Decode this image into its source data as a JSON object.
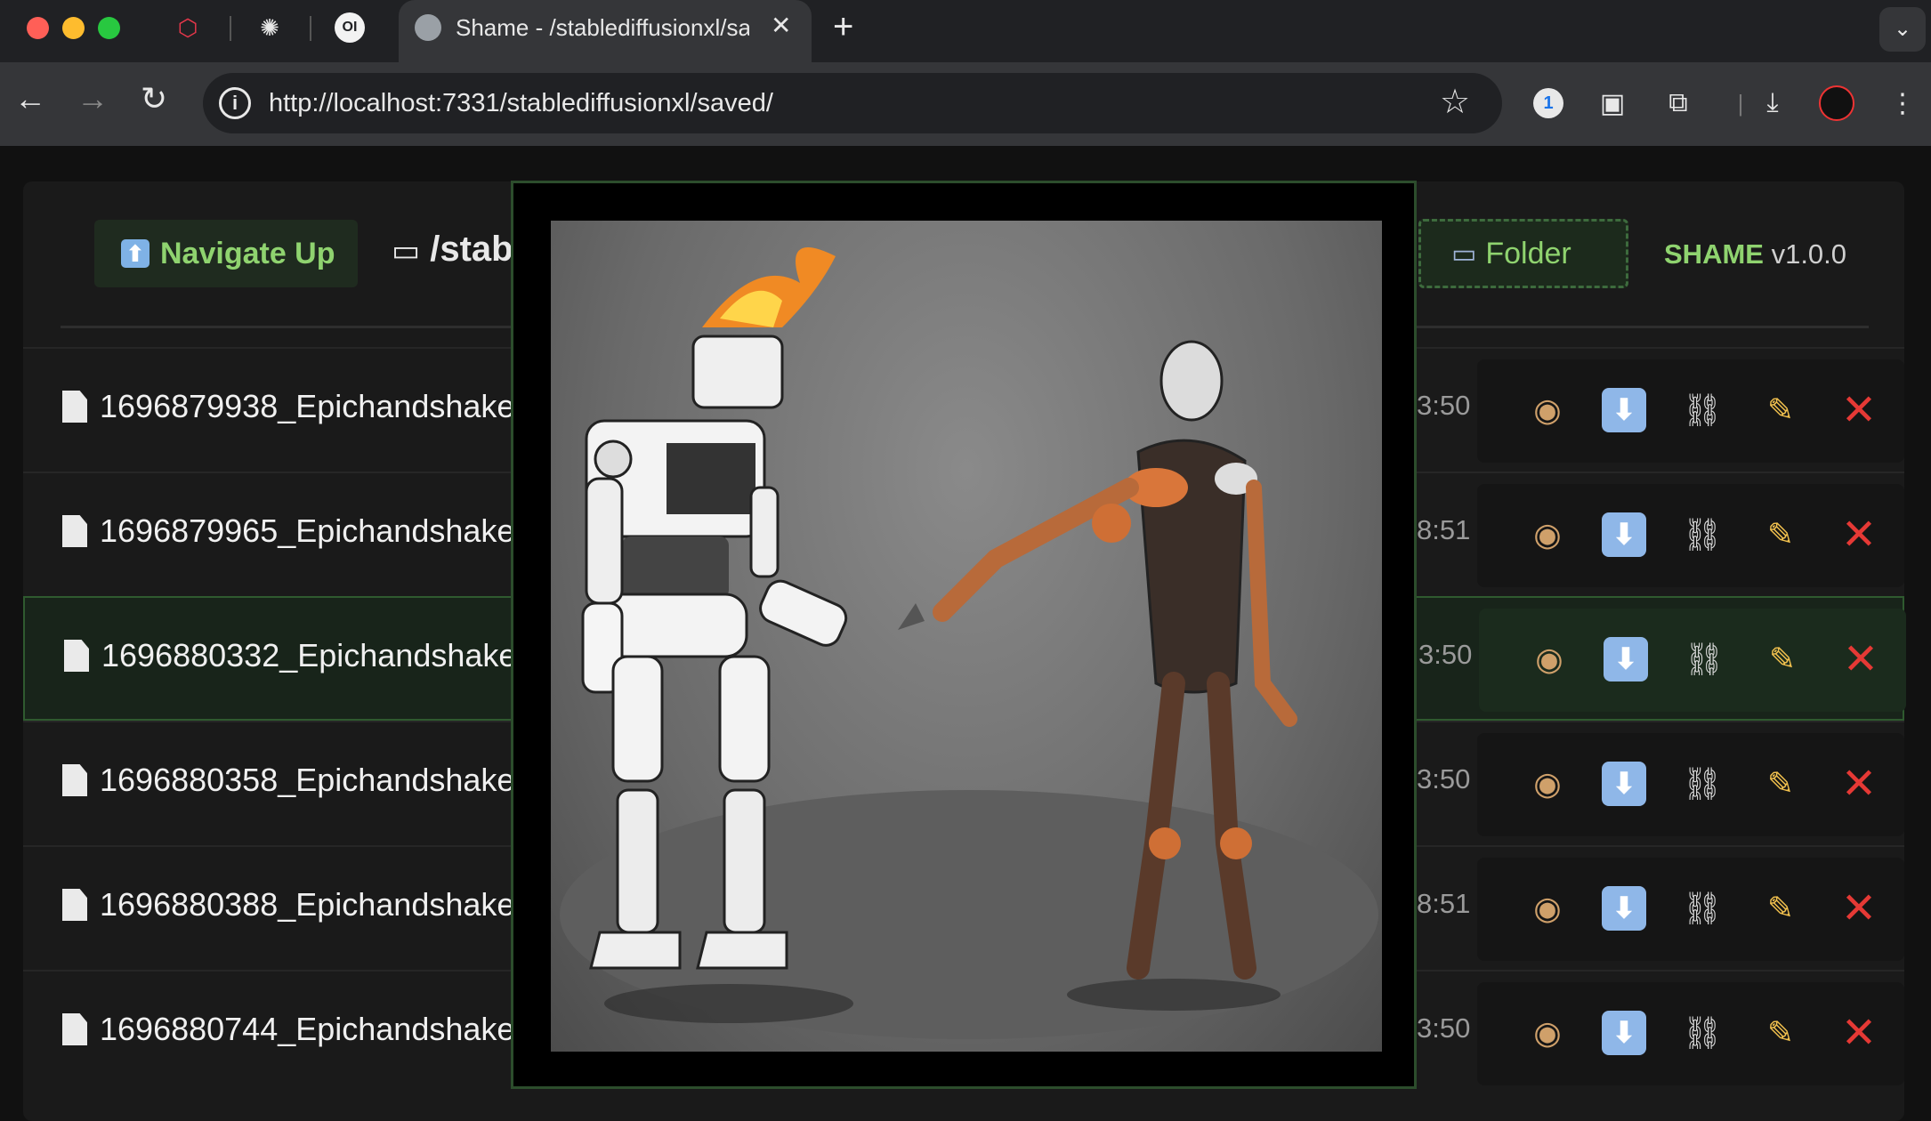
{
  "browser": {
    "active_tab_title": "Shame - /stablediffusionxl/saved/",
    "tab_close": "✕",
    "new_tab": "+",
    "url": "http://localhost:7331/stablediffusionxl/saved/"
  },
  "app": {
    "nav_up_label": "Navigate Up",
    "path_label": "/stab",
    "folder_label": "Folder",
    "brand_name": "SHAME",
    "brand_version": "v1.0.0"
  },
  "files": [
    {
      "name": "1696879938_Epichandshake",
      "time": "3:50"
    },
    {
      "name": "1696879965_Epichandshake",
      "time": "8:51"
    },
    {
      "name": "1696880332_Epichandshake",
      "time": "3:50"
    },
    {
      "name": "1696880358_Epichandshake",
      "time": "3:50"
    },
    {
      "name": "1696880388_Epichandshake",
      "time": "8:51"
    },
    {
      "name": "1696880744_Epichandshake",
      "time": "3:50"
    }
  ],
  "icons": {
    "view": "eye-icon",
    "download": "download-icon",
    "link": "link-icon",
    "edit": "pencil-icon",
    "delete": "delete-icon"
  },
  "colors": {
    "accent_green": "#8fd36f",
    "delete_red": "#e53935",
    "selected_row_bg": "#18241a"
  }
}
